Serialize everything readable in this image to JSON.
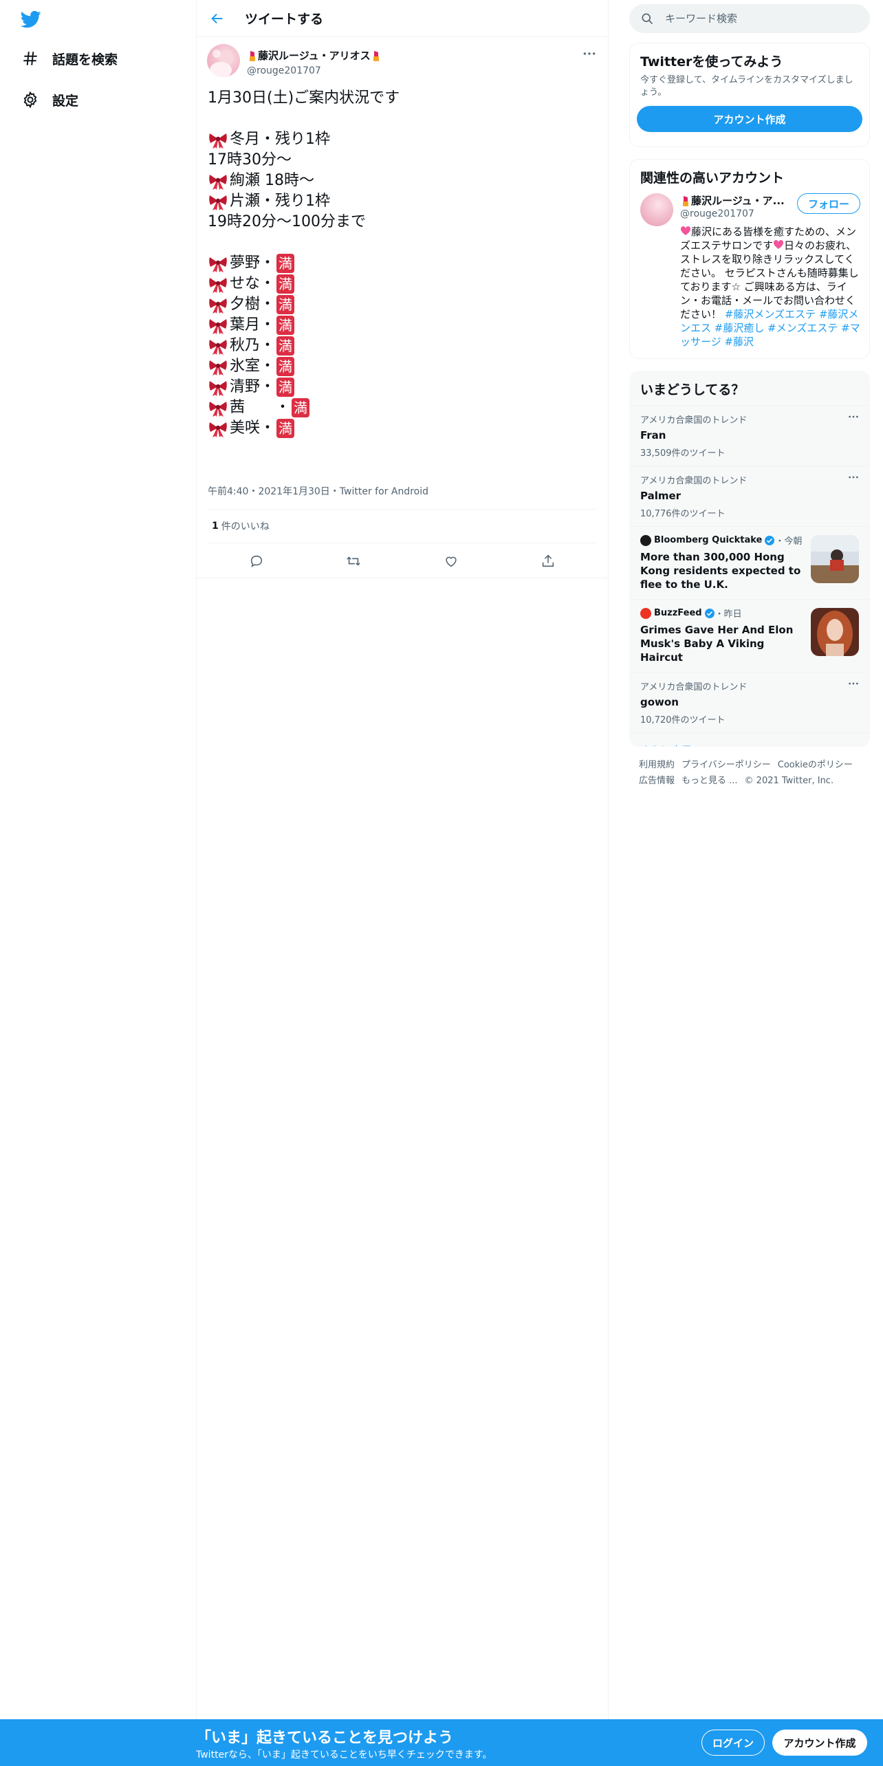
{
  "nav": {
    "explore_label": "話題を検索",
    "settings_label": "設定"
  },
  "header": {
    "title": "ツイートする"
  },
  "tweet": {
    "author_name": "藤沢ルージュ・アリオス",
    "author_handle": "@rouge201707",
    "lines": [
      {
        "text": "1月30日(土)ご案内状況です",
        "ribbon": false,
        "full": false
      },
      {
        "text": "",
        "ribbon": false,
        "full": false
      },
      {
        "text": "冬月・残り1枠",
        "ribbon": true,
        "full": false
      },
      {
        "text": "17時30分～",
        "ribbon": false,
        "full": false
      },
      {
        "text": "絢瀬 18時～",
        "ribbon": true,
        "full": false
      },
      {
        "text": "片瀬・残り1枠",
        "ribbon": true,
        "full": false
      },
      {
        "text": "19時20分～100分まで",
        "ribbon": false,
        "full": false
      },
      {
        "text": "",
        "ribbon": false,
        "full": false
      },
      {
        "text": "夢野・",
        "ribbon": true,
        "full": true
      },
      {
        "text": "せな・",
        "ribbon": true,
        "full": true
      },
      {
        "text": "夕樹・",
        "ribbon": true,
        "full": true
      },
      {
        "text": "葉月・",
        "ribbon": true,
        "full": true
      },
      {
        "text": "秋乃・",
        "ribbon": true,
        "full": true
      },
      {
        "text": "氷室・",
        "ribbon": true,
        "full": true
      },
      {
        "text": "清野・",
        "ribbon": true,
        "full": true
      },
      {
        "text": "茜　　・",
        "ribbon": true,
        "full": true
      },
      {
        "text": "美咲・",
        "ribbon": true,
        "full": true
      }
    ],
    "full_glyph": "満",
    "meta": "午前4:40・2021年1月30日・Twitter for Android",
    "like_count": "1",
    "like_label": "件のいいね"
  },
  "search": {
    "placeholder": "キーワード検索"
  },
  "signup_card": {
    "title": "Twitterを使ってみよう",
    "desc": "今すぐ登録して、タイムラインをカスタマイズしましょう。",
    "button": "アカウント作成"
  },
  "related": {
    "title": "関連性の高いアカウント",
    "name": "藤沢ルージュ・ア...",
    "handle": "@rouge201707",
    "follow": "フォロー",
    "bio_1": "藤沢にある皆様を癒すための、メンズエステサロンです",
    "bio_2": "日々のお疲れ、ストレスを取り除きリラックスしてください。 セラピストさんも随時募集しております☆ ご興味ある方は、ライン・お電話・メールでお問い合わせください！ ",
    "bio_tags": "#藤沢メンズエステ #藤沢メンエス #藤沢癒し #メンズエステ #マッサージ #藤沢"
  },
  "trends": {
    "title": "いまどうしてる？",
    "items": [
      {
        "context": "アメリカ合衆国のトレンド",
        "name": "Fran",
        "count": "33,509件のツイート"
      },
      {
        "context": "アメリカ合衆国のトレンド",
        "name": "Palmer",
        "count": "10,776件のツイート"
      }
    ],
    "news": [
      {
        "source": "Bloomberg Quicktake",
        "time": "・今朝",
        "title": "More than 300,000 Hong Kong residents expected to flee to the U.K."
      },
      {
        "source": "BuzzFeed",
        "time": "・昨日",
        "title": "Grimes Gave Her And Elon Musk's Baby A Viking Haircut"
      }
    ],
    "last": {
      "context": "アメリカ合衆国のトレンド",
      "name": "gowon",
      "count": "10,720件のツイート"
    },
    "show_more": "さらに表示"
  },
  "footer": {
    "terms": "利用規約",
    "privacy": "プライバシーポリシー",
    "cookie": "Cookieのポリシー",
    "ads": "広告情報",
    "more": "もっと見る ...",
    "copyright": "© 2021 Twitter, Inc."
  },
  "bottom_bar": {
    "title": "「いま」起きていることを見つけよう",
    "subtitle": "Twitterなら、「いま」起きていることをいち早くチェックできます。",
    "login": "ログイン",
    "signup": "アカウント作成"
  },
  "colors": {
    "accent": "#1d9bf0",
    "full_badge": "#dd2e44",
    "ribbon": "#be1931"
  }
}
